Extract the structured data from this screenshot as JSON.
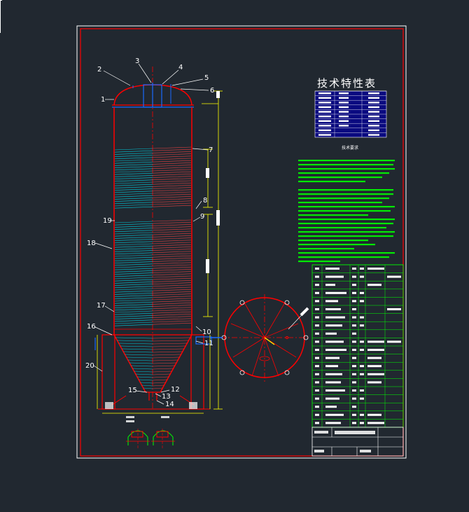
{
  "drawing": {
    "tech_table_title": "技术特性表",
    "notes_title": "技术要求",
    "part_labels": [
      "1",
      "2",
      "3",
      "4",
      "5",
      "6",
      "7",
      "8",
      "9",
      "10",
      "11",
      "12",
      "13",
      "14",
      "15",
      "16",
      "17",
      "18",
      "19",
      "20"
    ]
  },
  "colors": {
    "background": "#212830",
    "frame": "#ff0000",
    "vessel": "#ff0000",
    "dimension": "#ffff00",
    "leader": "#ffffff",
    "coil_left": "#00c8d8",
    "coil_right": "#e04040",
    "notes": "#00ff00",
    "table_border": "#00ff00",
    "tech_table": "#1a1aff"
  }
}
